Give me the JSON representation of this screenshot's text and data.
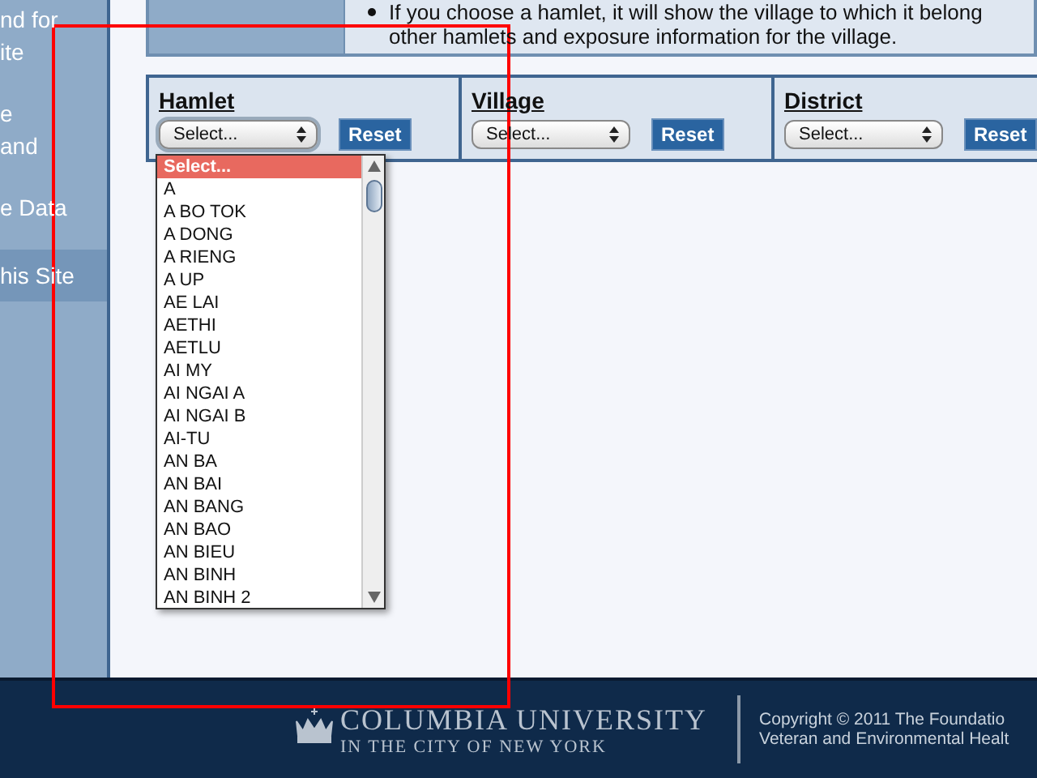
{
  "sidebar": {
    "items": [
      {
        "lines": [
          "nd for",
          "ite"
        ],
        "selected": false
      },
      {
        "lines": [
          "e",
          "and"
        ],
        "selected": false
      },
      {
        "lines": [
          "e Data"
        ],
        "selected": false
      },
      {
        "lines": [
          "his Site"
        ],
        "selected": true
      }
    ]
  },
  "notice": {
    "lines": [
      "If you choose a hamlet, it will show the village to which it belong",
      "other hamlets and exposure information for the village."
    ]
  },
  "filters": [
    {
      "label": "Hamlet",
      "value": "Select...",
      "button": "Reset",
      "open": true
    },
    {
      "label": "Village",
      "value": "Select...",
      "button": "Reset",
      "open": false
    },
    {
      "label": "District",
      "value": "Select...",
      "button": "Reset",
      "open": false
    }
  ],
  "dropdown": {
    "options": [
      {
        "label": "Select...",
        "selected": true
      },
      {
        "label": "A",
        "selected": false
      },
      {
        "label": "A BO TOK",
        "selected": false
      },
      {
        "label": "A DONG",
        "selected": false
      },
      {
        "label": "A RIENG",
        "selected": false
      },
      {
        "label": "A UP",
        "selected": false
      },
      {
        "label": "AE LAI",
        "selected": false
      },
      {
        "label": "AETHI",
        "selected": false
      },
      {
        "label": "AETLU",
        "selected": false
      },
      {
        "label": "AI MY",
        "selected": false
      },
      {
        "label": "AI NGAI A",
        "selected": false
      },
      {
        "label": "AI NGAI B",
        "selected": false
      },
      {
        "label": "AI-TU",
        "selected": false
      },
      {
        "label": "AN BA",
        "selected": false
      },
      {
        "label": "AN BAI",
        "selected": false
      },
      {
        "label": "AN BANG",
        "selected": false
      },
      {
        "label": "AN BAO",
        "selected": false
      },
      {
        "label": "AN BIEU",
        "selected": false
      },
      {
        "label": "AN BINH",
        "selected": false
      },
      {
        "label": "AN BINH 2",
        "selected": false
      }
    ]
  },
  "footer": {
    "university": "COLUMBIA UNIVERSITY",
    "tagline": "IN THE CITY OF NEW YORK",
    "copyright": [
      "Copyright © 2011 The Foundatio",
      "Veteran and Environmental Healt"
    ]
  }
}
